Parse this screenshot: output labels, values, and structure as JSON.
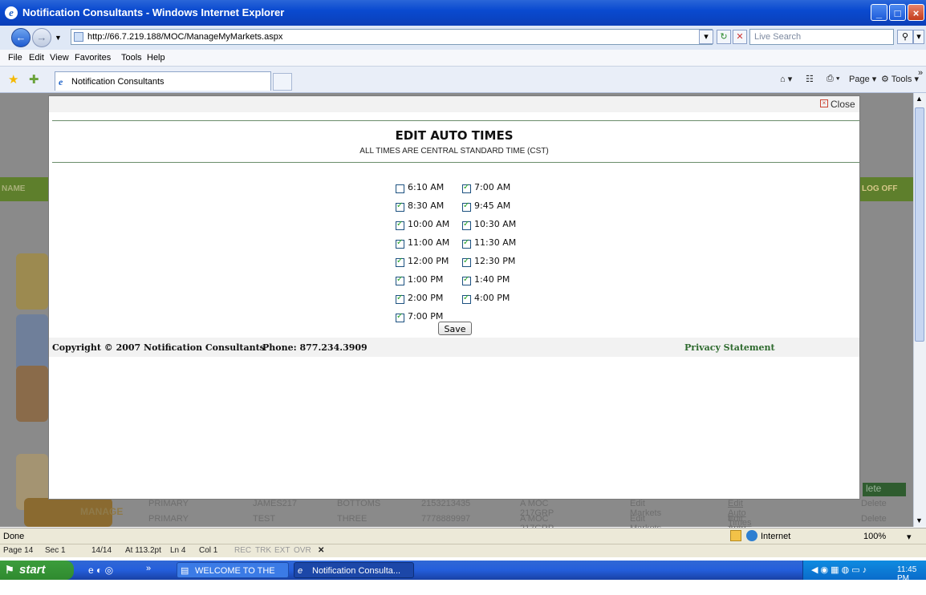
{
  "window": {
    "title": "Notification Consultants - Windows Internet Explorer",
    "address": "http://66.7.219.188/MOC/ManageMyMarkets.aspx",
    "search_placeholder": "Live Search",
    "menu": [
      "File",
      "Edit",
      "View",
      "Favorites",
      "Tools",
      "Help"
    ],
    "tab_label": "Notification Consultants",
    "page_cmd": "Page",
    "tools_cmd": "Tools"
  },
  "modal": {
    "close_label": "Close",
    "title": "EDIT AUTO TIMES",
    "subtitle": "ALL TIMES ARE CENTRAL STANDARD TIME (CST)",
    "times": [
      {
        "label": "6:10 AM",
        "checked": false
      },
      {
        "label": "7:00 AM",
        "checked": true
      },
      {
        "label": "8:30 AM",
        "checked": true
      },
      {
        "label": "9:45 AM",
        "checked": true
      },
      {
        "label": "10:00 AM",
        "checked": true
      },
      {
        "label": "10:30 AM",
        "checked": true
      },
      {
        "label": "11:00 AM",
        "checked": true
      },
      {
        "label": "11:30 AM",
        "checked": true
      },
      {
        "label": "12:00 PM",
        "checked": true
      },
      {
        "label": "12:30 PM",
        "checked": true
      },
      {
        "label": "1:00 PM",
        "checked": true
      },
      {
        "label": "1:40 PM",
        "checked": true
      },
      {
        "label": "2:00 PM",
        "checked": true
      },
      {
        "label": "4:00 PM",
        "checked": true
      },
      {
        "label": "7:00 PM",
        "checked": true
      }
    ],
    "save_label": "Save",
    "copyright": "Copyright © 2007 Notification Consultants",
    "phone": "Phone: 877.234.3909",
    "privacy": "Privacy Statement"
  },
  "background_page": {
    "name_label": "NAME",
    "logoff_label": "LOG OFF",
    "delete_header": "lete",
    "manage_label": "MANAGE",
    "rows": [
      [
        "PRIMARY",
        "JAMES217",
        "BOTTOMS",
        "2153213435",
        "A MOC 217GRP",
        "Edit Markets",
        "Edit Auto Times",
        "Delete"
      ],
      [
        "PRIMARY",
        "TEST",
        "THREE",
        "7778889997",
        "A MOC 217GRP",
        "Edit Markets",
        "Edit Auto Times",
        "Delete"
      ]
    ]
  },
  "status": {
    "text": "Done",
    "zone": "Internet",
    "zoom": "100%"
  },
  "word_status": {
    "page": "Page 14",
    "sec": "Sec 1",
    "pages": "14/14",
    "at": "At 113.2pt",
    "ln": "Ln 4",
    "col": "Col 1",
    "modes": [
      "REC",
      "TRK",
      "EXT",
      "OVR"
    ]
  },
  "taskbar": {
    "start": "start",
    "tasks": [
      "WELCOME TO THE M...",
      "Notification Consulta..."
    ],
    "clock": "11:45 PM"
  },
  "colors": {
    "modal_rule": "#6b8d6b",
    "check": "#21a121",
    "privacy": "#2e6a2e"
  }
}
